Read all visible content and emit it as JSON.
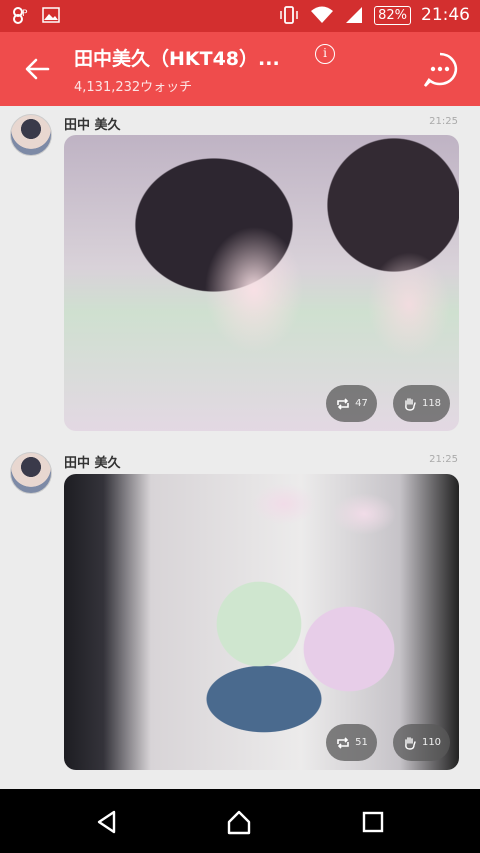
{
  "status": {
    "battery": "82%",
    "time": "21:46"
  },
  "header": {
    "title": "田中美久（HKT48）...",
    "subtitle": "4,131,232ウォッチ"
  },
  "posts": [
    {
      "author": "田中 美久",
      "time": "21:25",
      "retweets": "47",
      "claps": "118"
    },
    {
      "author": "田中 美久",
      "time": "21:25",
      "retweets": "51",
      "claps": "110"
    }
  ]
}
